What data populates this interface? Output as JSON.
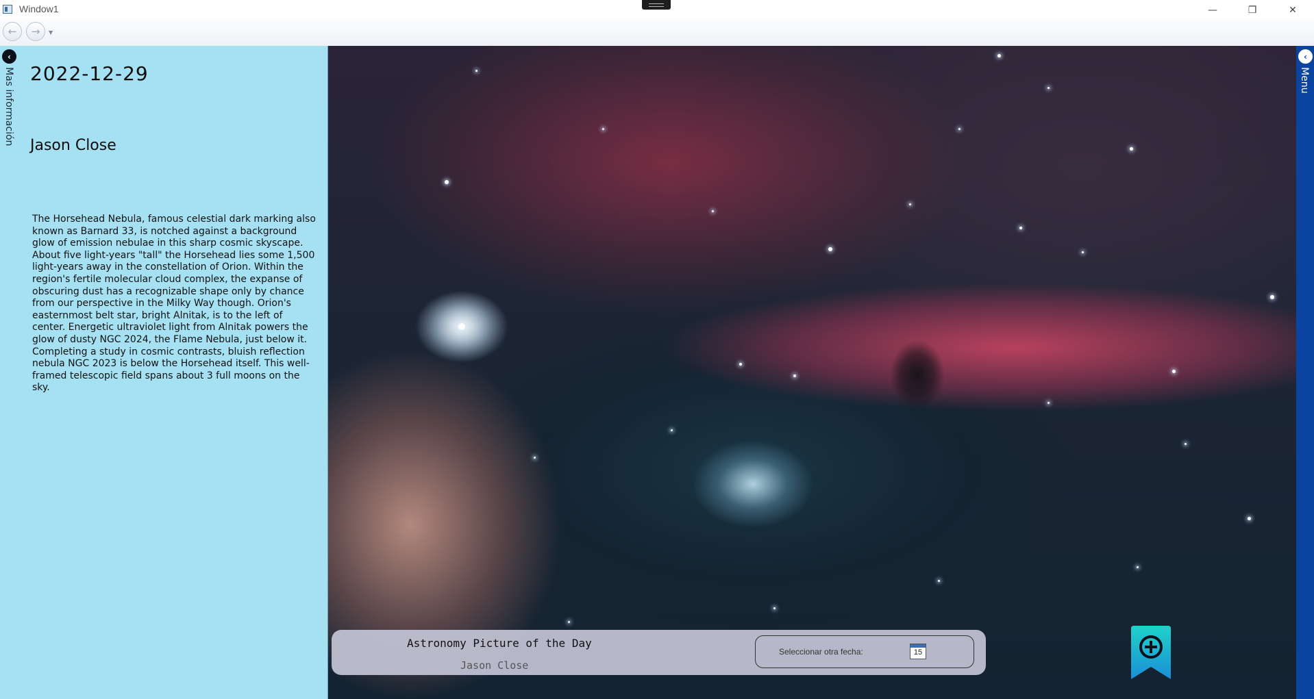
{
  "window": {
    "title": "Window1",
    "min_glyph": "—",
    "max_glyph": "❐",
    "close_glyph": "✕"
  },
  "nav": {
    "back_glyph": "←",
    "forward_glyph": "→",
    "dropdown_glyph": "▼"
  },
  "side_panel": {
    "toggle_glyph": "‹",
    "vertical_label": "Mas información",
    "date": "2022-12-29",
    "author": "Jason Close",
    "explanation": "The Horsehead Nebula, famous celestial dark marking also known as Barnard 33, is notched against a background glow of emission nebulae in this sharp cosmic skyscape. About five light-years \"tall\" the Horsehead lies some 1,500 light-years away in the constellation of Orion. Within the region's fertile molecular cloud complex, the expanse of obscuring dust has a recognizable shape only by chance from our perspective in the Milky Way though. Orion's easternmost belt star, bright Alnitak, is to the left of center.  Energetic ultraviolet light from Alnitak powers the glow of dusty NGC 2024, the Flame Nebula, just below it. Completing a study in cosmic contrasts, bluish reflection nebula NGC 2023 is below the Horsehead itself. This well-framed telescopic field spans about 3 full moons on the sky.",
    "background_color": "#a5e1f2"
  },
  "info_bar": {
    "title": "Astronomy Picture of the Day",
    "author": "Jason Close",
    "date_placeholder": "Seleccionar otra fecha:",
    "calendar_day": "15"
  },
  "right_panel": {
    "toggle_glyph": "‹",
    "vertical_label": "Menu",
    "color": "#0a44a0"
  },
  "icons": {
    "bookmark": "bookmark-add-icon",
    "calendar": "calendar-icon"
  },
  "accent_colors": {
    "bookmark_top": "#1fd2c9",
    "bookmark_bottom": "#1a8fd6"
  }
}
